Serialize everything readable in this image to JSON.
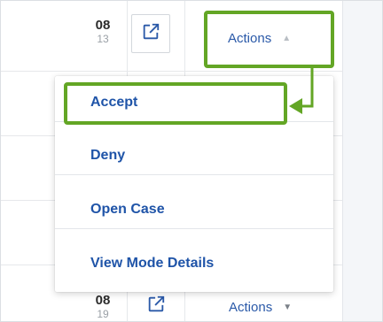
{
  "rows": [
    {
      "date_main": "08",
      "date_sub": "13",
      "actions_label": "Actions"
    },
    {
      "date_main": "08",
      "date_sub": "19",
      "actions_label": "Actions"
    }
  ],
  "menu": {
    "items": [
      {
        "label": "Accept",
        "highlighted": true
      },
      {
        "label": "Deny"
      },
      {
        "label": "Open Case"
      },
      {
        "label": "View Mode Details"
      }
    ]
  },
  "icons": {
    "external_link": "open-in-new-icon",
    "caret_up": "caret-up-icon",
    "caret_down": "caret-down-icon",
    "arrow": "arrow-left-icon"
  },
  "colors": {
    "highlight": "#63a625",
    "link": "#1f54a8",
    "actions_text": "#2a59a8"
  }
}
